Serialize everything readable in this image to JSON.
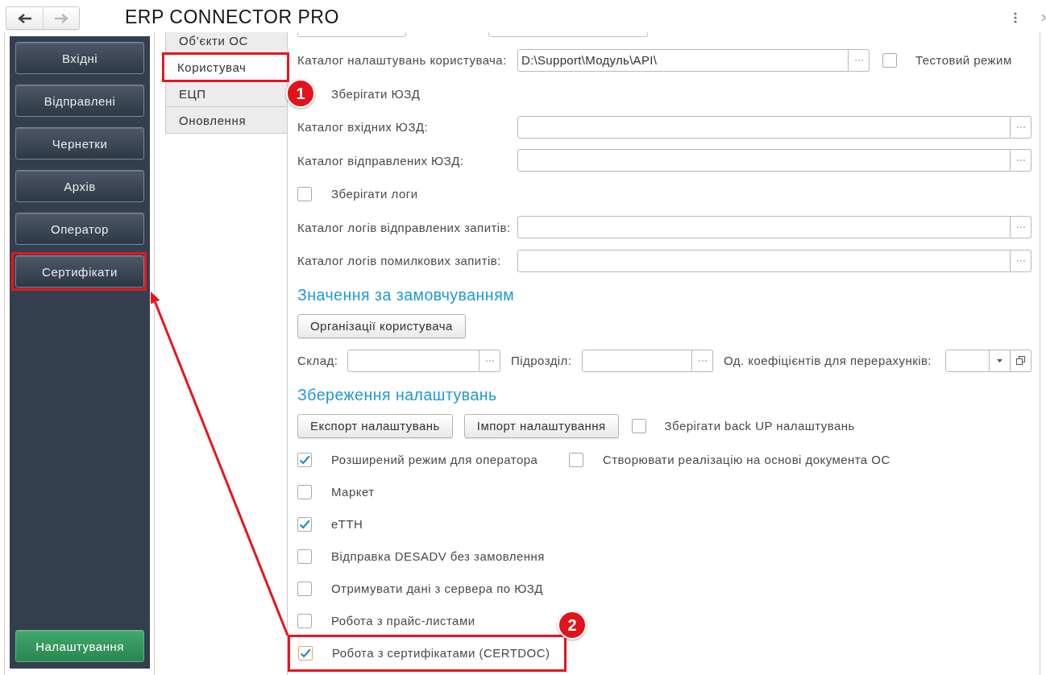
{
  "window": {
    "title": "ERP CONNECTOR PRO"
  },
  "nav_buttons": [
    {
      "kind": "back",
      "disabled": false
    },
    {
      "kind": "forward",
      "disabled": true
    }
  ],
  "sidebar": {
    "items": [
      {
        "label": "Вхідні",
        "selected": false,
        "highlighted": false
      },
      {
        "label": "Відправлені",
        "selected": false,
        "highlighted": false
      },
      {
        "label": "Чернетки",
        "selected": false,
        "highlighted": false
      },
      {
        "label": "Архів",
        "selected": false,
        "highlighted": false
      },
      {
        "label": "Оператор",
        "selected": false,
        "highlighted": false
      },
      {
        "label": "Сертифікати",
        "selected": false,
        "highlighted": true
      }
    ],
    "footer_items": [
      {
        "label": "Налаштування",
        "selected": true,
        "highlighted": false
      }
    ]
  },
  "tabs": [
    {
      "label": "Об’єкти ОС",
      "selected": false,
      "highlighted": false
    },
    {
      "label": "Користувач",
      "selected": true,
      "highlighted": true
    },
    {
      "label": "ЕЦП",
      "selected": false,
      "highlighted": false
    },
    {
      "label": "Оновлення",
      "selected": false,
      "highlighted": false
    }
  ],
  "form": {
    "rows": [
      {
        "kind": "path",
        "label": "Каталог налаштувань користувача:",
        "value": "D:\\Support\\Модуль\\API\\",
        "extra_checkbox": {
          "label": "Тестовий режим",
          "checked": false
        }
      },
      {
        "kind": "check",
        "label": "Зберігати ЮЗД",
        "highlighted": false
      },
      {
        "kind": "path",
        "label": "Каталог вхідних ЮЗД:"
      },
      {
        "kind": "path",
        "label": "Каталог відправлених ЮЗД:"
      },
      {
        "kind": "check",
        "label": "Зберігати логи",
        "checked": false,
        "highlighted": false
      },
      {
        "kind": "path",
        "label": "Каталог логів відправлених запитів:"
      },
      {
        "kind": "path",
        "label": "Каталог логів помилкових запитів:"
      },
      {
        "kind": "heading",
        "text": "Значення за замовчуванням"
      },
      {
        "kind": "buttons",
        "buttons": [
          {
            "label": "Організації користувача"
          }
        ]
      },
      {
        "kind": "selectors",
        "fields": [
          {
            "kind": "choice",
            "label": "Склад:"
          },
          {
            "kind": "choice",
            "label": "Підрозділ:"
          },
          {
            "kind": "dropdown",
            "label": "Од. коефіцієнтів для перерахунків:"
          }
        ]
      },
      {
        "kind": "heading",
        "text": "Збереження налаштувань"
      },
      {
        "kind": "buttons",
        "buttons": [
          {
            "label": "Експорт налаштувань"
          },
          {
            "label": "Імпорт налаштування"
          }
        ],
        "checkbox": {
          "label": "Зберігати back UP налаштувань",
          "checked": false
        }
      },
      {
        "kind": "checks",
        "items": [
          {
            "label": "Розширений режим для оператора",
            "checked": true
          },
          {
            "label": "Створювати реалізацію на основі документа ОС",
            "checked": false
          }
        ]
      },
      {
        "kind": "check",
        "label": "Маркет",
        "checked": false,
        "highlighted": false
      },
      {
        "kind": "check",
        "label": "еТТН",
        "checked": true,
        "highlighted": false
      },
      {
        "kind": "check",
        "label": "Відправка DESADV без замовлення",
        "checked": false,
        "highlighted": false
      },
      {
        "kind": "check",
        "label": "Отримувати дані з сервера по ЮЗД",
        "checked": false,
        "highlighted": false
      },
      {
        "kind": "check",
        "label": "Робота з прайс-листами",
        "checked": false,
        "highlighted": false
      },
      {
        "kind": "check",
        "label": "Робота з сертифікатами (CERTDOC)",
        "checked": true,
        "focused": true,
        "highlighted": true
      }
    ]
  },
  "annotations": [
    {
      "label": "1"
    },
    {
      "label": "2"
    }
  ]
}
